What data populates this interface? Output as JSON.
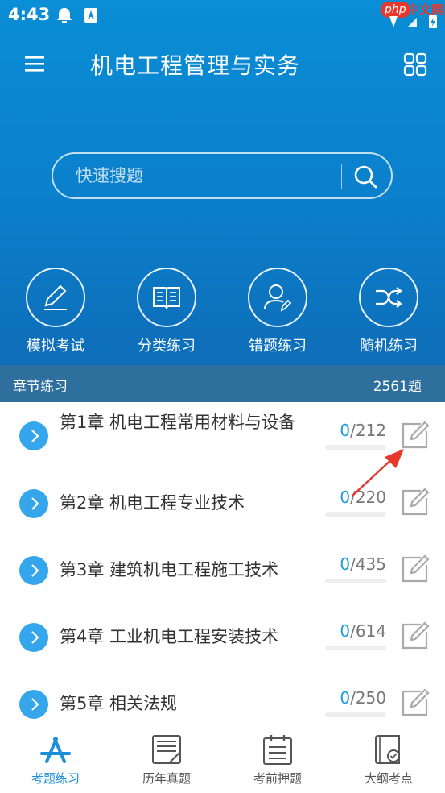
{
  "status_bar": {
    "time": "4:43"
  },
  "watermark": {
    "php": "php",
    "cn": "中文网"
  },
  "header": {
    "title": "机电工程管理与实务"
  },
  "search": {
    "placeholder": "快速搜题"
  },
  "quick_actions": [
    {
      "label": "模拟考试",
      "icon": "pen-icon"
    },
    {
      "label": "分类练习",
      "icon": "book-icon"
    },
    {
      "label": "错题练习",
      "icon": "user-edit-icon"
    },
    {
      "label": "随机练习",
      "icon": "shuffle-icon"
    }
  ],
  "section": {
    "title": "章节练习",
    "count": "2561题"
  },
  "chapters": [
    {
      "title": "第1章 机电工程常用材料与设备",
      "done": "0",
      "total": "/212",
      "progress": 0
    },
    {
      "title": "第2章 机电工程专业技术",
      "done": "0",
      "total": "/220",
      "progress": 0
    },
    {
      "title": "第3章 建筑机电工程施工技术",
      "done": "0",
      "total": "/435",
      "progress": 0
    },
    {
      "title": "第4章 工业机电工程安装技术",
      "done": "0",
      "total": "/614",
      "progress": 0
    },
    {
      "title": "第5章 相关法规",
      "done": "0",
      "total": "/250",
      "progress": 0
    }
  ],
  "tabs": [
    {
      "label": "考题练习",
      "active": true,
      "icon": "app-store-icon"
    },
    {
      "label": "历年真题",
      "active": false,
      "icon": "document-icon"
    },
    {
      "label": "考前押题",
      "active": false,
      "icon": "calendar-list-icon"
    },
    {
      "label": "大纲考点",
      "active": false,
      "icon": "book-check-icon"
    }
  ],
  "colors": {
    "primary": "#0a8ed5",
    "accent": "#1a9be0",
    "section_bar": "#2f6f9e",
    "annotation": "#e8372c"
  }
}
